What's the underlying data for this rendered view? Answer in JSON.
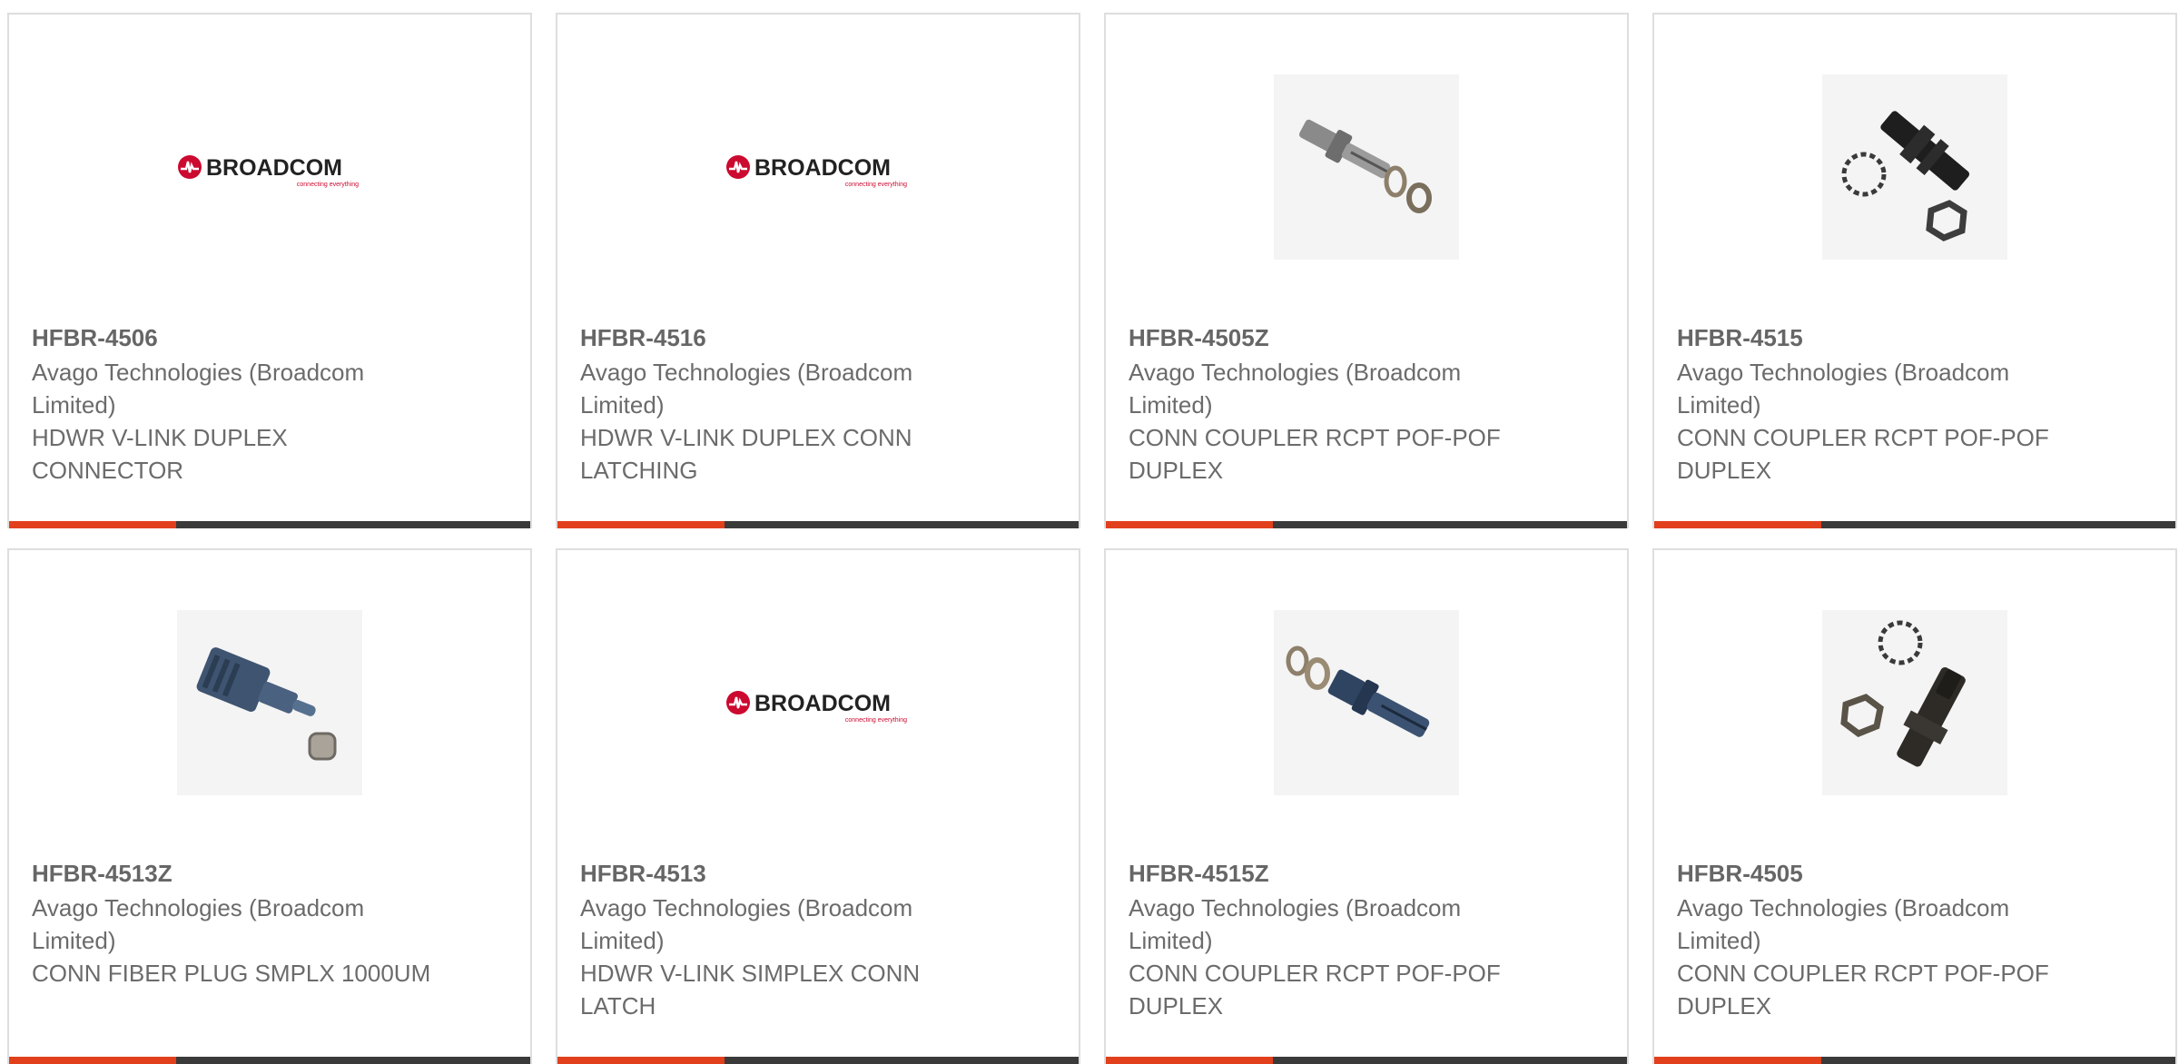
{
  "accent_color": "#e2401c",
  "bar_color": "#3a3a3a",
  "cards": [
    {
      "part": "HFBR-4506",
      "mfr": "Avago Technologies (Broadcom Limited)",
      "desc": "HDWR V-LINK DUPLEX CONNECTOR",
      "image": "broadcom-logo",
      "logo_text": "BROADCOM",
      "logo_tagline": "connecting everything"
    },
    {
      "part": "HFBR-4516",
      "mfr": "Avago Technologies (Broadcom Limited)",
      "desc": "HDWR V-LINK DUPLEX CONN LATCHING",
      "image": "broadcom-logo",
      "logo_text": "BROADCOM",
      "logo_tagline": "connecting everything"
    },
    {
      "part": "HFBR-4505Z",
      "mfr": "Avago Technologies (Broadcom Limited)",
      "desc": "CONN COUPLER RCPT POF-POF DUPLEX",
      "image": "gray-coupler-photo"
    },
    {
      "part": "HFBR-4515",
      "mfr": "Avago Technologies (Broadcom Limited)",
      "desc": "CONN COUPLER RCPT POF-POF DUPLEX",
      "image": "black-coupler-photo"
    },
    {
      "part": "HFBR-4513Z",
      "mfr": "Avago Technologies (Broadcom Limited)",
      "desc": "CONN FIBER PLUG SMPLX 1000UM",
      "image": "fiber-plug-photo"
    },
    {
      "part": "HFBR-4513",
      "mfr": "Avago Technologies (Broadcom Limited)",
      "desc": "HDWR V-LINK SIMPLEX CONN LATCH",
      "image": "broadcom-logo",
      "logo_text": "BROADCOM",
      "logo_tagline": "connecting everything"
    },
    {
      "part": "HFBR-4515Z",
      "mfr": "Avago Technologies (Broadcom Limited)",
      "desc": "CONN COUPLER RCPT POF-POF DUPLEX",
      "image": "blue-coupler-photo"
    },
    {
      "part": "HFBR-4505",
      "mfr": "Avago Technologies (Broadcom Limited)",
      "desc": "CONN COUPLER RCPT POF-POF DUPLEX",
      "image": "dark-coupler-photo"
    }
  ]
}
